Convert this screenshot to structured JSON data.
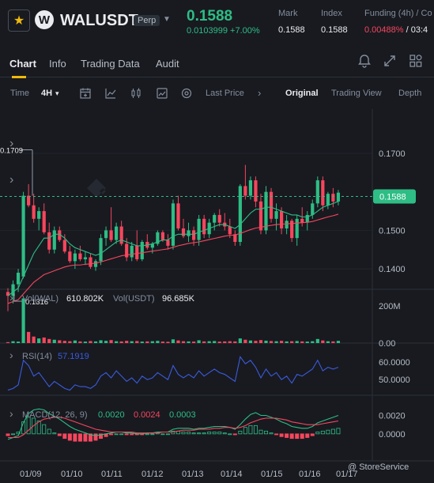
{
  "header": {
    "star_icon": "star-icon",
    "coin_letter": "W",
    "symbol": "WALUSDT",
    "contract_type": "Perp",
    "last_price": "0.1588",
    "change": "0.0103999 +7.00%",
    "mark_label": "Mark",
    "mark_value": "0.1588",
    "index_label": "Index",
    "index_value": "0.1588",
    "funding_label": "Funding (4h) / Co",
    "funding_rate": "0.00488%",
    "funding_countdown": "/ 03:4"
  },
  "tabs": [
    "Chart",
    "Info",
    "Trading Data",
    "Audit"
  ],
  "toolbar": {
    "time_label": "Time",
    "interval": "4H",
    "price_type": "Last Price",
    "views": [
      "Original",
      "Trading View",
      "Depth"
    ]
  },
  "colors": {
    "up": "#2ebd85",
    "down": "#f6465d",
    "accent": "#f0b90b",
    "ma_short": "#2ebd85",
    "ma_long": "#f6465d",
    "rsi": "#3b5bdb"
  },
  "chart_data": [
    {
      "type": "candlestick",
      "y_ticks": [
        "0.1700",
        "0.1500",
        "0.1400"
      ],
      "y_tick_values": [
        0.17,
        0.15,
        0.14
      ],
      "ylim": [
        0.1353,
        0.1815
      ],
      "x_ticks": [
        "01/09",
        "01/10",
        "01/11",
        "01/12",
        "01/13",
        "01/14",
        "01/15",
        "01/16",
        "01/17"
      ],
      "current_price_label": "0.1588",
      "current_price": 0.1588,
      "high_marker": "0.1709",
      "high_value": 0.1709,
      "low_marker": "0.1316",
      "low_value": 0.1316,
      "candles": [
        [
          0.134,
          0.135,
          0.129,
          0.133
        ],
        [
          0.133,
          0.137,
          0.131,
          0.136
        ],
        [
          0.136,
          0.14,
          0.134,
          0.139
        ],
        [
          0.138,
          0.16,
          0.1375,
          0.159
        ],
        [
          0.159,
          0.162,
          0.156,
          0.1565
        ],
        [
          0.1565,
          0.1595,
          0.152,
          0.153
        ],
        [
          0.153,
          0.156,
          0.15,
          0.155
        ],
        [
          0.155,
          0.157,
          0.149,
          0.1495
        ],
        [
          0.1495,
          0.152,
          0.144,
          0.145
        ],
        [
          0.145,
          0.151,
          0.144,
          0.15
        ],
        [
          0.15,
          0.151,
          0.147,
          0.1475
        ],
        [
          0.1475,
          0.149,
          0.144,
          0.1445
        ],
        [
          0.1445,
          0.146,
          0.1415,
          0.142
        ],
        [
          0.142,
          0.145,
          0.14,
          0.144
        ],
        [
          0.144,
          0.146,
          0.142,
          0.1425
        ],
        [
          0.1425,
          0.1445,
          0.141,
          0.143
        ],
        [
          0.143,
          0.144,
          0.14,
          0.1405
        ],
        [
          0.1405,
          0.1425,
          0.1395,
          0.142
        ],
        [
          0.142,
          0.149,
          0.141,
          0.148
        ],
        [
          0.148,
          0.151,
          0.146,
          0.15
        ],
        [
          0.15,
          0.156,
          0.147,
          0.1475
        ],
        [
          0.1475,
          0.152,
          0.1465,
          0.151
        ],
        [
          0.151,
          0.1525,
          0.146,
          0.1465
        ],
        [
          0.1465,
          0.148,
          0.142,
          0.143
        ],
        [
          0.143,
          0.147,
          0.142,
          0.146
        ],
        [
          0.146,
          0.15,
          0.142,
          0.1425
        ],
        [
          0.1425,
          0.1475,
          0.142,
          0.147
        ],
        [
          0.147,
          0.149,
          0.145,
          0.1455
        ],
        [
          0.1455,
          0.147,
          0.144,
          0.1465
        ],
        [
          0.1465,
          0.15,
          0.146,
          0.1495
        ],
        [
          0.1495,
          0.15,
          0.147,
          0.1475
        ],
        [
          0.1475,
          0.149,
          0.145,
          0.146
        ],
        [
          0.146,
          0.158,
          0.145,
          0.157
        ],
        [
          0.157,
          0.159,
          0.15,
          0.1505
        ],
        [
          0.1505,
          0.153,
          0.148,
          0.1485
        ],
        [
          0.1485,
          0.152,
          0.147,
          0.15
        ],
        [
          0.15,
          0.151,
          0.146,
          0.1475
        ],
        [
          0.1475,
          0.154,
          0.146,
          0.153
        ],
        [
          0.153,
          0.154,
          0.148,
          0.149
        ],
        [
          0.149,
          0.153,
          0.148,
          0.152
        ],
        [
          0.152,
          0.1545,
          0.15,
          0.154
        ],
        [
          0.154,
          0.1555,
          0.151,
          0.152
        ],
        [
          0.152,
          0.1545,
          0.15,
          0.151
        ],
        [
          0.151,
          0.153,
          0.148,
          0.149
        ],
        [
          0.149,
          0.15,
          0.146,
          0.147
        ],
        [
          0.147,
          0.162,
          0.146,
          0.1615
        ],
        [
          0.1615,
          0.167,
          0.158,
          0.159
        ],
        [
          0.159,
          0.164,
          0.158,
          0.163
        ],
        [
          0.163,
          0.164,
          0.156,
          0.1575
        ],
        [
          0.1575,
          0.1595,
          0.149,
          0.15
        ],
        [
          0.15,
          0.1615,
          0.149,
          0.16
        ],
        [
          0.16,
          0.161,
          0.152,
          0.153
        ],
        [
          0.153,
          0.157,
          0.15,
          0.155
        ],
        [
          0.155,
          0.156,
          0.149,
          0.1505
        ],
        [
          0.1505,
          0.154,
          0.149,
          0.1525
        ],
        [
          0.1525,
          0.153,
          0.147,
          0.148
        ],
        [
          0.148,
          0.154,
          0.146,
          0.153
        ],
        [
          0.153,
          0.156,
          0.151,
          0.152
        ],
        [
          0.152,
          0.155,
          0.15,
          0.154
        ],
        [
          0.154,
          0.158,
          0.153,
          0.157
        ],
        [
          0.157,
          0.164,
          0.156,
          0.163
        ],
        [
          0.163,
          0.164,
          0.155,
          0.1565
        ],
        [
          0.1565,
          0.16,
          0.1555,
          0.1595
        ],
        [
          0.1595,
          0.161,
          0.156,
          0.1575
        ],
        [
          0.1575,
          0.1605,
          0.1565,
          0.1598
        ]
      ],
      "ma_short": [
        0.133,
        0.134,
        0.135,
        0.138,
        0.141,
        0.144,
        0.146,
        0.148,
        0.148,
        0.149,
        0.149,
        0.148,
        0.1465,
        0.1455,
        0.145,
        0.1445,
        0.144,
        0.1435,
        0.144,
        0.145,
        0.146,
        0.147,
        0.1475,
        0.147,
        0.1465,
        0.146,
        0.146,
        0.1462,
        0.1465,
        0.147,
        0.1475,
        0.1475,
        0.1485,
        0.149,
        0.149,
        0.149,
        0.149,
        0.1495,
        0.15,
        0.1505,
        0.151,
        0.1515,
        0.1515,
        0.151,
        0.1505,
        0.1515,
        0.153,
        0.1545,
        0.1555,
        0.1555,
        0.156,
        0.156,
        0.1555,
        0.155,
        0.1545,
        0.154,
        0.154,
        0.1535,
        0.1535,
        0.154,
        0.155,
        0.156,
        0.1565,
        0.157,
        0.1575
      ],
      "ma_long": [
        0.131,
        0.1315,
        0.132,
        0.1335,
        0.135,
        0.1365,
        0.1375,
        0.1385,
        0.139,
        0.1395,
        0.14,
        0.1405,
        0.1408,
        0.141,
        0.141,
        0.1412,
        0.1413,
        0.1415,
        0.1418,
        0.1422,
        0.1426,
        0.143,
        0.1434,
        0.1436,
        0.1438,
        0.144,
        0.1442,
        0.1444,
        0.1446,
        0.1448,
        0.145,
        0.1452,
        0.1456,
        0.146,
        0.1463,
        0.1466,
        0.1468,
        0.147,
        0.1473,
        0.1476,
        0.1479,
        0.1482,
        0.1485,
        0.1487,
        0.1488,
        0.1492,
        0.1497,
        0.1502,
        0.1506,
        0.1508,
        0.1511,
        0.1513,
        0.1515,
        0.1516,
        0.1517,
        0.1518,
        0.1519,
        0.152,
        0.1521,
        0.1523,
        0.1527,
        0.1531,
        0.1535,
        0.1538,
        0.1542
      ]
    },
    {
      "type": "bar",
      "label_prefix": "Vol(WAL)",
      "label_value": "610.802K",
      "label2": "Vol(USDT)",
      "label2_value": "96.685K",
      "y_ticks": [
        "200M",
        "0.00"
      ],
      "y_tick_values": [
        200,
        0
      ],
      "ylim": [
        0,
        255
      ],
      "unit": "M",
      "values": [
        5,
        10,
        8,
        240,
        60,
        35,
        25,
        30,
        22,
        18,
        15,
        12,
        10,
        14,
        9,
        8,
        11,
        9,
        15,
        12,
        16,
        10,
        9,
        12,
        10,
        11,
        8,
        9,
        10,
        12,
        8,
        7,
        20,
        14,
        10,
        9,
        8,
        15,
        9,
        10,
        11,
        8,
        9,
        10,
        9,
        25,
        18,
        14,
        12,
        16,
        13,
        11,
        10,
        12,
        9,
        10,
        11,
        9,
        8,
        10,
        22,
        14,
        10,
        9,
        12
      ]
    },
    {
      "type": "line",
      "label": "RSI(14)",
      "label_value": "57.1919",
      "y_ticks": [
        "60.0000",
        "50.0000"
      ],
      "y_tick_values": [
        60,
        50
      ],
      "ylim": [
        42,
        69
      ],
      "values": [
        44,
        45,
        47,
        61,
        58,
        52,
        54,
        50,
        46,
        49,
        47,
        45,
        44,
        47,
        46,
        46,
        45,
        47,
        52,
        54,
        51,
        55,
        52,
        49,
        51,
        48,
        52,
        50,
        51,
        54,
        52,
        50,
        58,
        53,
        51,
        53,
        51,
        55,
        52,
        54,
        56,
        54,
        53,
        51,
        49,
        63,
        59,
        61,
        57,
        51,
        56,
        52,
        54,
        50,
        52,
        48,
        53,
        52,
        54,
        56,
        61,
        55,
        57,
        56,
        57
      ]
    },
    {
      "type": "bar+line",
      "label": "MACD(12, 26, 9)",
      "macd_value": "0.0020",
      "signal_value": "0.0024",
      "hist_value": "0.0003",
      "y_ticks": [
        "0.0020",
        "0.0000"
      ],
      "y_tick_values": [
        0.002,
        0.0
      ],
      "ylim": [
        -0.0025,
        0.0035
      ],
      "macd": [
        -0.0006,
        -0.0004,
        -0.0002,
        0.0012,
        0.0022,
        0.0026,
        0.0027,
        0.0026,
        0.0022,
        0.0019,
        0.0016,
        0.0012,
        0.0008,
        0.0005,
        0.0003,
        0.0001,
        -0.0001,
        -0.0002,
        -0.0001,
        0.0,
        0.0001,
        0.0002,
        0.0002,
        0.0001,
        0.0001,
        0.0,
        0.0,
        0.0001,
        0.0001,
        0.0002,
        0.0002,
        0.0002,
        0.0005,
        0.0006,
        0.0006,
        0.0006,
        0.0005,
        0.0006,
        0.0006,
        0.0007,
        0.0008,
        0.0008,
        0.0008,
        0.0007,
        0.0005,
        0.001,
        0.0016,
        0.0021,
        0.0023,
        0.002,
        0.002,
        0.0018,
        0.0016,
        0.0013,
        0.0011,
        0.0008,
        0.0007,
        0.0006,
        0.0006,
        0.0008,
        0.0012,
        0.0014,
        0.0016,
        0.0018,
        0.002
      ],
      "signal": [
        -0.0004,
        -0.0004,
        -0.0004,
        -0.0001,
        0.0004,
        0.0009,
        0.0013,
        0.0016,
        0.0017,
        0.0018,
        0.0018,
        0.0017,
        0.0015,
        0.0013,
        0.0011,
        0.0009,
        0.0007,
        0.0005,
        0.0004,
        0.0003,
        0.0002,
        0.0002,
        0.0002,
        0.0002,
        0.0002,
        0.0001,
        0.0001,
        0.0001,
        0.0001,
        0.0001,
        0.0002,
        0.0002,
        0.0002,
        0.0003,
        0.0004,
        0.0004,
        0.0004,
        0.0005,
        0.0005,
        0.0005,
        0.0006,
        0.0006,
        0.0007,
        0.0007,
        0.0006,
        0.0007,
        0.0009,
        0.0012,
        0.0014,
        0.0016,
        0.0017,
        0.0017,
        0.0017,
        0.0016,
        0.0015,
        0.0013,
        0.0012,
        0.0011,
        0.001,
        0.001,
        0.001,
        0.0011,
        0.0012,
        0.0013,
        0.0014
      ],
      "hist": [
        -0.0002,
        0.0,
        0.0002,
        0.0013,
        0.0018,
        0.0017,
        0.0014,
        0.001,
        0.0005,
        0.0001,
        -0.0002,
        -0.0005,
        -0.0007,
        -0.0008,
        -0.0008,
        -0.0008,
        -0.0008,
        -0.0007,
        -0.0005,
        -0.0003,
        -0.0001,
        0.0,
        0.0,
        -0.0001,
        -0.0001,
        -0.0001,
        -0.0001,
        0.0,
        0.0,
        0.0001,
        0.0,
        0.0,
        0.0003,
        0.0003,
        0.0002,
        0.0002,
        0.0001,
        0.0001,
        0.0001,
        0.0002,
        0.0002,
        0.0002,
        0.0001,
        0.0,
        -0.0001,
        0.0003,
        0.0007,
        0.0009,
        0.0009,
        0.0004,
        0.0003,
        0.0001,
        -0.0001,
        -0.0003,
        -0.0004,
        -0.0005,
        -0.0005,
        -0.0005,
        -0.0004,
        -0.0002,
        0.0002,
        0.0003,
        0.0004,
        0.0005,
        0.0006
      ]
    }
  ],
  "watermark": "@ StoreService"
}
